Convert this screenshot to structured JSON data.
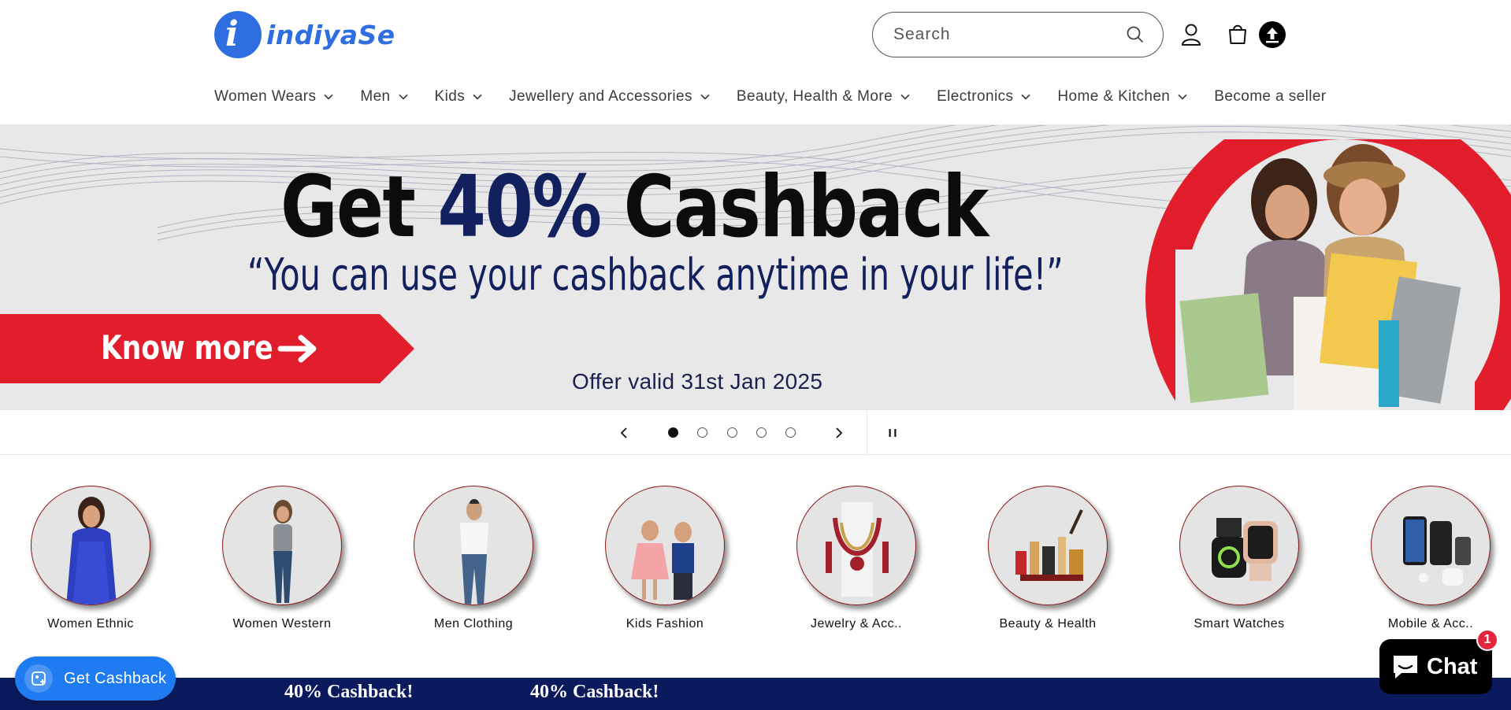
{
  "header": {
    "logo_text": "indiyaSe",
    "logo_glyph": "i",
    "search": {
      "placeholder": "Search",
      "value": ""
    },
    "icons": [
      "search-icon",
      "account-icon",
      "cart-icon",
      "upload-icon"
    ]
  },
  "nav": {
    "items": [
      {
        "label": "Women Wears",
        "dropdown": true
      },
      {
        "label": "Men",
        "dropdown": true
      },
      {
        "label": "Kids",
        "dropdown": true
      },
      {
        "label": "Jewellery and Accessories",
        "dropdown": true
      },
      {
        "label": "Beauty, Health & More",
        "dropdown": true
      },
      {
        "label": "Electronics",
        "dropdown": true
      },
      {
        "label": "Home & Kitchen",
        "dropdown": true
      },
      {
        "label": "Become a seller",
        "dropdown": false
      }
    ]
  },
  "banner": {
    "headline_pre": "Get ",
    "headline_pct": "40%",
    "headline_post": " Cashback",
    "subline": "“You can use your cashback anytime in your life!”",
    "cta": "Know more",
    "offer": "Offer valid 31st Jan 2025",
    "colors": {
      "accent_red": "#e21e2d",
      "navy": "#13205e"
    }
  },
  "slider": {
    "slide_count": 5,
    "active_slide": 1
  },
  "categories": [
    {
      "label": "Women Ethnic"
    },
    {
      "label": "Women Western"
    },
    {
      "label": "Men Clothing"
    },
    {
      "label": "Kids Fashion"
    },
    {
      "label": "Jewelry & Acc.."
    },
    {
      "label": "Beauty & Health"
    },
    {
      "label": "Smart Watches"
    },
    {
      "label": "Mobile & Acc.."
    }
  ],
  "ticker": {
    "items": [
      "k!",
      "40% Cashback!",
      "40% Cashback!"
    ]
  },
  "cashback_button": {
    "label": "Get Cashback"
  },
  "chat": {
    "label": "Chat",
    "badge": "1"
  }
}
